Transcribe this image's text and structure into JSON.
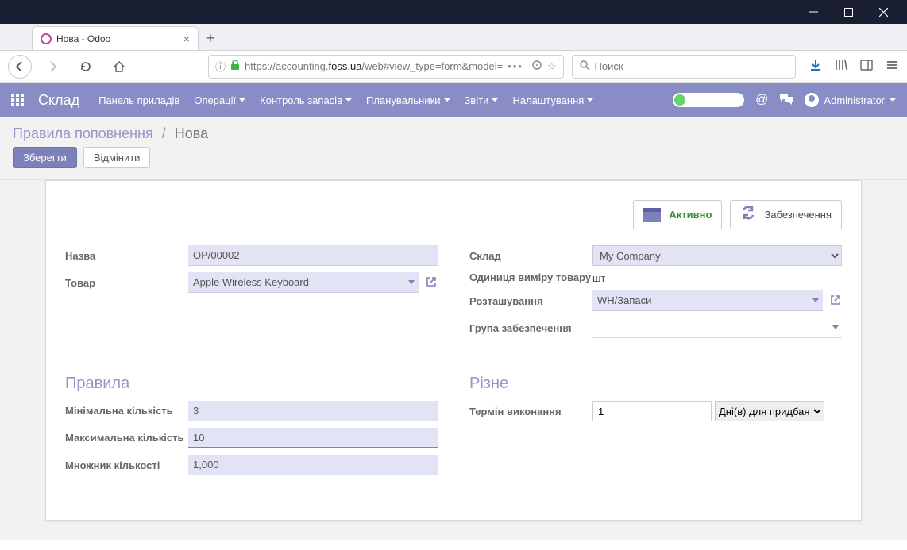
{
  "window": {
    "tab_title": "Нова - Odoo"
  },
  "toolbar": {
    "url_prefix": "https://accounting.",
    "url_host": "foss.ua",
    "url_path": "/web#view_type=form&model=",
    "search_placeholder": "Поиск"
  },
  "navbar": {
    "brand": "Склад",
    "items": [
      {
        "label": "Панель приладів",
        "dropdown": false
      },
      {
        "label": "Операції",
        "dropdown": true
      },
      {
        "label": "Контроль запасів",
        "dropdown": true
      },
      {
        "label": "Планувальники",
        "dropdown": true
      },
      {
        "label": "Звіти",
        "dropdown": true
      },
      {
        "label": "Налаштування",
        "dropdown": true
      }
    ],
    "user": "Administrator"
  },
  "control_panel": {
    "breadcrumb_root": "Правила поповнення",
    "breadcrumb_current": "Нова",
    "save_label": "Зберегти",
    "discard_label": "Відмінити"
  },
  "status": {
    "active_label": "Активно",
    "proc_label": "Забезпечення"
  },
  "form": {
    "left": {
      "name_label": "Назва",
      "name_value": "OP/00002",
      "product_label": "Товар",
      "product_value": "Apple Wireless Keyboard"
    },
    "right": {
      "warehouse_label": "Склад",
      "warehouse_value": "My Company",
      "uom_label": "Одиниця виміру товару",
      "uom_value": "шт",
      "location_label": "Розташування",
      "location_value": "WH/Запаси",
      "group_label": "Група забезпечення",
      "group_value": ""
    }
  },
  "rules": {
    "section_label": "Правила",
    "min_label": "Мінімальна кількість",
    "min_value": "3",
    "max_label": "Максимальна кількість",
    "max_value": "10",
    "mult_label": "Множник кількості",
    "mult_value": "1,000"
  },
  "misc": {
    "section_label": "Різне",
    "lead_label": "Термін виконання",
    "lead_value": "1",
    "lead_type": "Дні(в) для придбан"
  }
}
